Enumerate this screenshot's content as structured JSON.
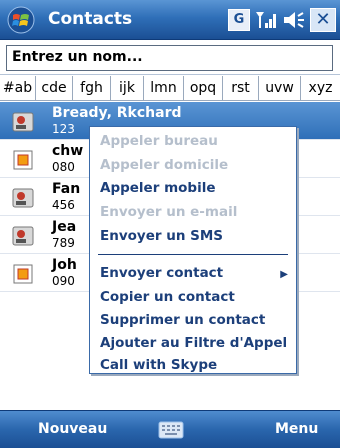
{
  "titlebar": {
    "title": "Contacts",
    "tray_g": "G",
    "close": "✕"
  },
  "search": {
    "value": "Entrez un nom..."
  },
  "tabs": [
    "#ab",
    "cde",
    "fgh",
    "ijk",
    "lmn",
    "opq",
    "rst",
    "uvw",
    "xyz"
  ],
  "contacts": [
    {
      "name": "Bready, Rkchard",
      "number": "123",
      "icon": "contact-card-icon",
      "selected": true
    },
    {
      "name": "chw",
      "number": "080",
      "icon": "sim-contact-icon",
      "selected": false
    },
    {
      "name": "Fan",
      "number": "456",
      "icon": "contact-card-icon",
      "selected": false
    },
    {
      "name": "Jea",
      "number": "789",
      "icon": "contact-card-icon",
      "selected": false
    },
    {
      "name": "Joh",
      "number": "090",
      "icon": "sim-contact-icon",
      "selected": false
    }
  ],
  "menu": {
    "group1": [
      {
        "label": "Appeler bureau",
        "enabled": false
      },
      {
        "label": "Appeler domicile",
        "enabled": false
      },
      {
        "label": "Appeler mobile",
        "enabled": true
      },
      {
        "label": "Envoyer un e-mail",
        "enabled": false
      },
      {
        "label": "Envoyer un SMS",
        "enabled": true
      }
    ],
    "group2": [
      {
        "label": "Envoyer contact",
        "enabled": true,
        "submenu": true
      },
      {
        "label": "Copier un contact",
        "enabled": true
      },
      {
        "label": "Supprimer un contact",
        "enabled": true
      },
      {
        "label": "Ajouter au Filtre d'Appel",
        "enabled": true
      },
      {
        "label": "Call with Skype",
        "enabled": true
      }
    ],
    "submenu_arrow": "▶"
  },
  "bottombar": {
    "left": "Nouveau",
    "right": "Menu"
  },
  "colors": {
    "accent": "#2f6fb8",
    "menu_text": "#1c3f7a",
    "menu_disabled": "#b5bfcc"
  }
}
